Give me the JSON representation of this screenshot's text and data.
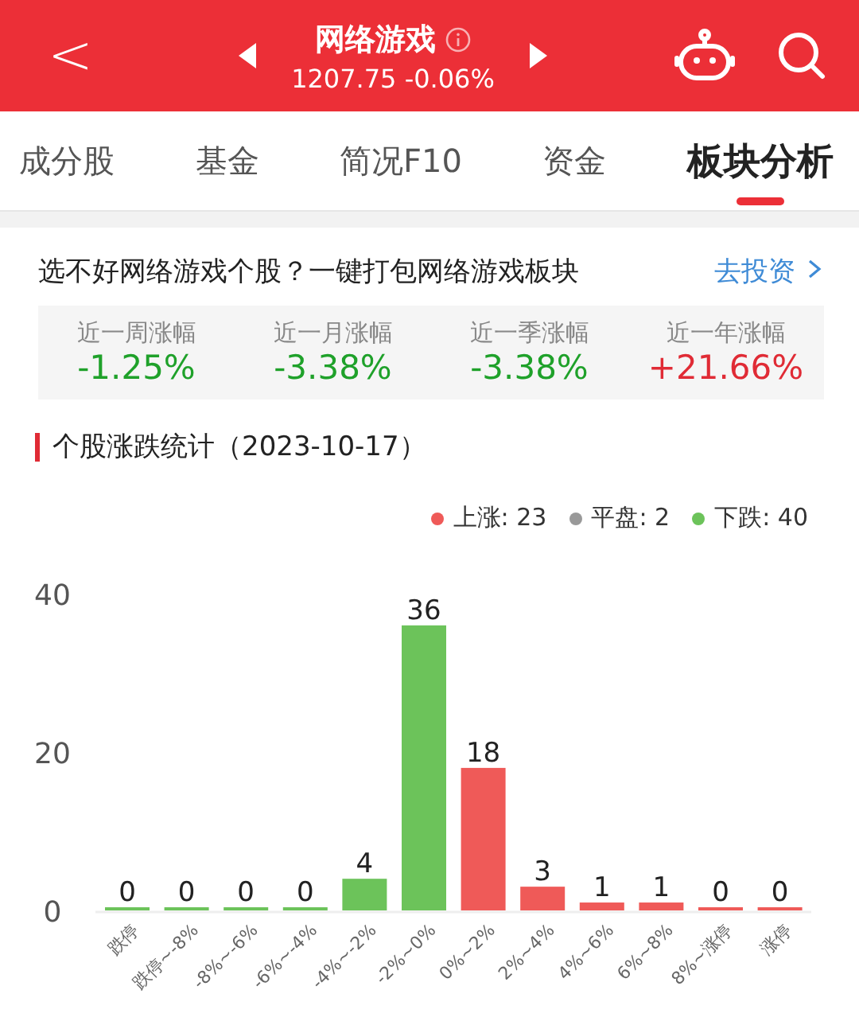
{
  "header": {
    "back": "<",
    "title": "网络游戏",
    "quote": "1207.75 -0.06%"
  },
  "tabs": [
    {
      "label": "成分股",
      "selected": false
    },
    {
      "label": "基金",
      "selected": false
    },
    {
      "label": "简况F10",
      "selected": false
    },
    {
      "label": "资金",
      "selected": false
    },
    {
      "label": "板块分析",
      "selected": true
    }
  ],
  "promo": {
    "text": "选不好网络游戏个股？一键打包网络游戏板块",
    "link": "去投资"
  },
  "returns": [
    {
      "label": "近一周涨幅",
      "value": "-1.25%",
      "kind": "down"
    },
    {
      "label": "近一月涨幅",
      "value": "-3.38%",
      "kind": "down"
    },
    {
      "label": "近一季涨幅",
      "value": "-3.38%",
      "kind": "down"
    },
    {
      "label": "近一年涨幅",
      "value": "+21.66%",
      "kind": "up"
    }
  ],
  "stats": {
    "title": "个股涨跌统计（2023-10-17）",
    "legend": [
      {
        "label": "上涨: 23",
        "color": "#ef5a58"
      },
      {
        "label": "平盘: 2",
        "color": "#999999"
      },
      {
        "label": "下跌: 40",
        "color": "#6cc35a"
      }
    ],
    "chart_data": {
      "type": "bar",
      "categories": [
        "跌停",
        "跌停~-8%",
        "-8%~-6%",
        "-6%~-4%",
        "-4%~-2%",
        "-2%~0%",
        "0%~2%",
        "2%~4%",
        "4%~6%",
        "6%~8%",
        "8%~涨停",
        "涨停"
      ],
      "series": [
        {
          "color": "#6cc35a",
          "values": [
            0,
            0,
            0,
            0,
            4,
            36,
            null,
            null,
            null,
            null,
            null,
            null
          ]
        },
        {
          "color": "#ef5a58",
          "values": [
            null,
            null,
            null,
            null,
            null,
            null,
            18,
            3,
            1,
            1,
            0,
            0
          ]
        }
      ],
      "ylim": [
        0,
        40
      ],
      "yticks": [
        0,
        20,
        40
      ],
      "data_labels": true
    }
  }
}
